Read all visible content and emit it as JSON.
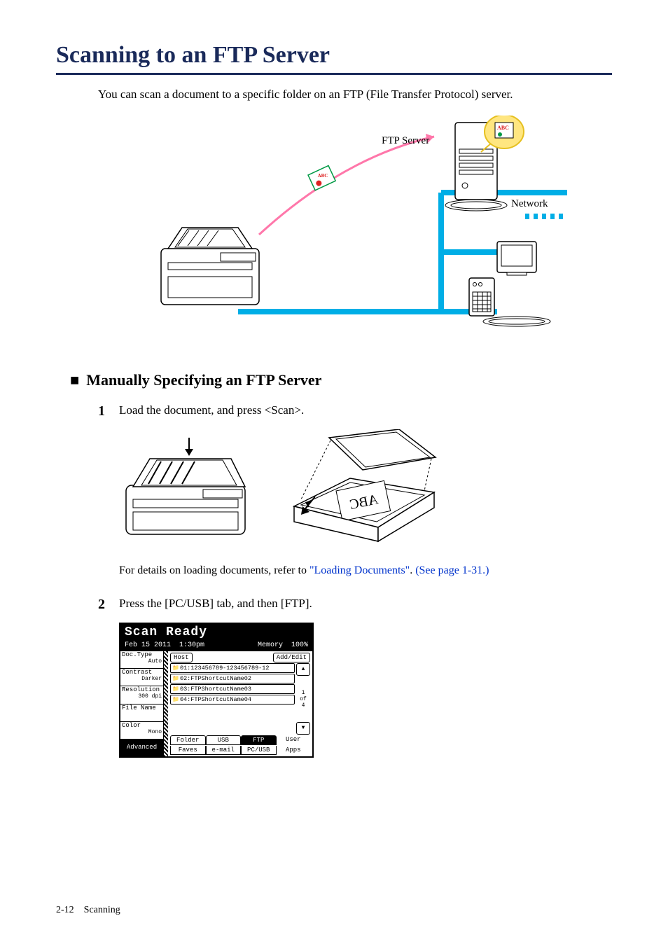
{
  "page": {
    "title": "Scanning to an FTP Server",
    "intro": "You can scan a document to a specific folder on an FTP (File Transfer Protocol) server.",
    "footer_num": "2-12",
    "footer_label": "Scanning"
  },
  "diagram": {
    "ftp_label": "FTP Server",
    "network_label": "Network",
    "doc_label": "ABC"
  },
  "section": {
    "heading": "Manually Specifying an FTP Server"
  },
  "steps": {
    "s1": {
      "num": "1",
      "text": "Load the document, and press <Scan>.",
      "caption_prefix": "For details on loading documents, refer to ",
      "caption_link1": "\"Loading Documents\"",
      "caption_link2": "(See page 1-31.)",
      "caption_mid": ". "
    },
    "s2": {
      "num": "2",
      "text": "Press the [PC/USB] tab, and then [FTP]."
    }
  },
  "display": {
    "title": "Scan Ready",
    "date": "Feb 15 2011",
    "time": "1:30pm",
    "mem_label": "Memory",
    "mem_val": "100%",
    "left": {
      "doctype": "Doc.Type",
      "doctype_val": "Auto",
      "contrast": "Contrast",
      "contrast_val": "Darker",
      "resolution": "Resolution",
      "resolution_val": "300 dpi",
      "filename": "File Name",
      "color": "Color",
      "color_val": "Mono",
      "advanced": "Advanced"
    },
    "top": {
      "host": "Host",
      "addedit": "Add/Edit"
    },
    "items": {
      "i1": "01:123456789-123456789-12",
      "i2": "02:FTPShortcutName02",
      "i3": "03:FTPShortcutName03",
      "i4": "04:FTPShortcutName04"
    },
    "scroll": {
      "page_cur": "1",
      "page_of": "of",
      "page_total": "4",
      "up": "▲",
      "down": "▼"
    },
    "tabs1": {
      "folder": "Folder",
      "usb": "USB",
      "ftp": "FTP",
      "user": "User"
    },
    "tabs2": {
      "faves": "Faves",
      "email": "e-mail",
      "pcusb": "PC/USB",
      "apps": "Apps"
    }
  }
}
